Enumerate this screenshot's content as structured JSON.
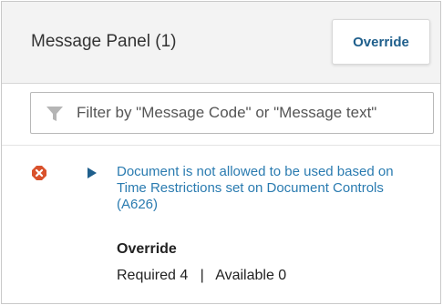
{
  "panel": {
    "title": "Message Panel (1)",
    "override_button_label": "Override"
  },
  "filter": {
    "placeholder": "Filter by \"Message Code\" or \"Message text\"",
    "icon": "filter-icon"
  },
  "messages": [
    {
      "severity_icon": "error-icon",
      "expand_icon": "caret-right-icon",
      "text": "Document is not allowed to be used based on Time Restrictions set on Document Controls (A626)",
      "override": {
        "heading": "Override",
        "required_label": "Required",
        "required_value": "4",
        "separator": "|",
        "available_label": "Available",
        "available_value": "0",
        "stats_text": "Required 4   |   Available 0"
      }
    }
  ],
  "colors": {
    "header_bg": "#f3f3f3",
    "link": "#2a7bb0",
    "button_text": "#1f5f8c",
    "error": "#d9522c"
  }
}
